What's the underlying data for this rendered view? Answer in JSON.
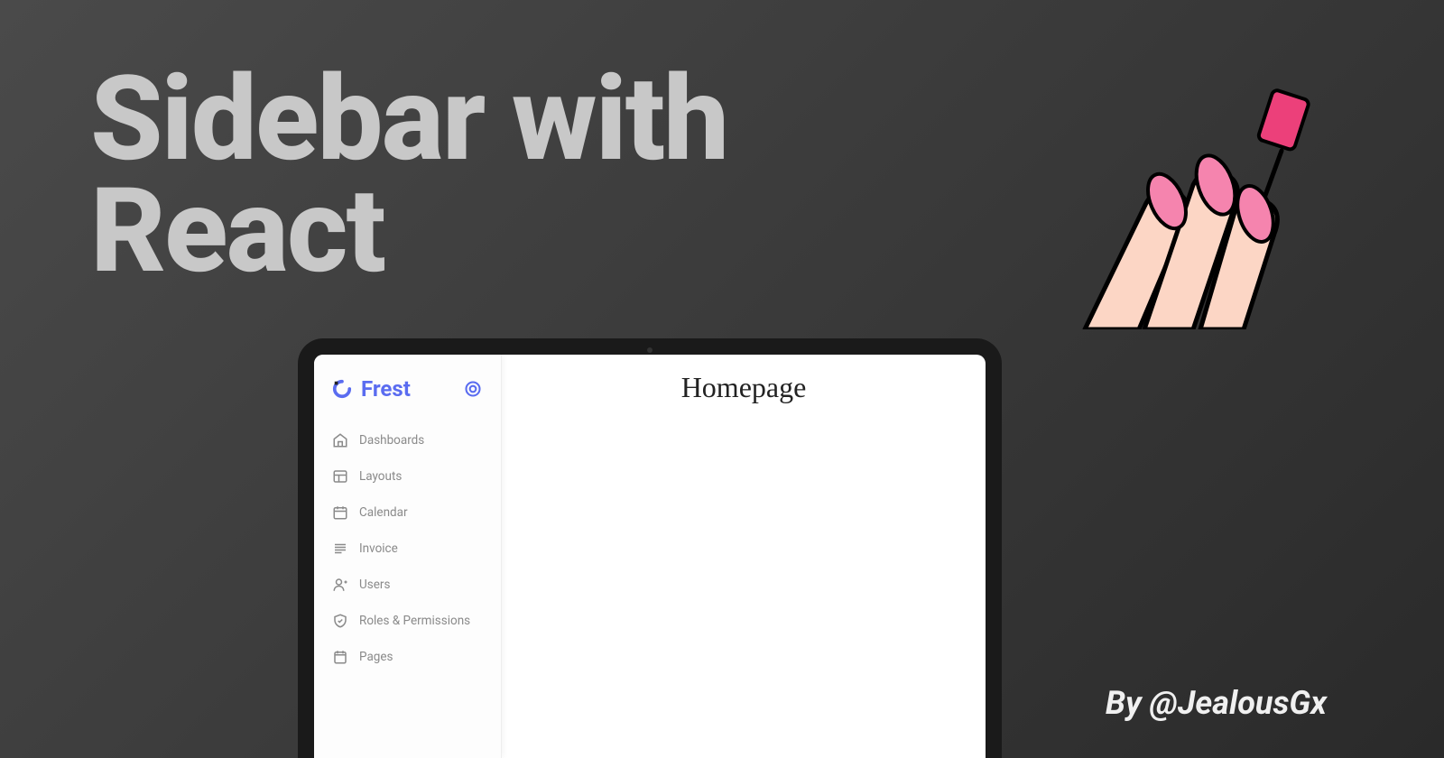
{
  "headline_line1": "Sidebar with",
  "headline_line2": "React",
  "credit": "By @JealousGx",
  "app": {
    "brand": "Frest",
    "page_title": "Homepage",
    "sidebar": {
      "items": [
        {
          "label": "Dashboards",
          "icon": "home"
        },
        {
          "label": "Layouts",
          "icon": "layout"
        },
        {
          "label": "Calendar",
          "icon": "calendar"
        },
        {
          "label": "Invoice",
          "icon": "list"
        },
        {
          "label": "Users",
          "icon": "user"
        },
        {
          "label": "Roles & Permissions",
          "icon": "shield"
        },
        {
          "label": "Pages",
          "icon": "page"
        }
      ]
    }
  },
  "colors": {
    "accent": "#5a6cf0",
    "nail_pink": "#f06292",
    "muted_text": "#8a8a8a"
  }
}
